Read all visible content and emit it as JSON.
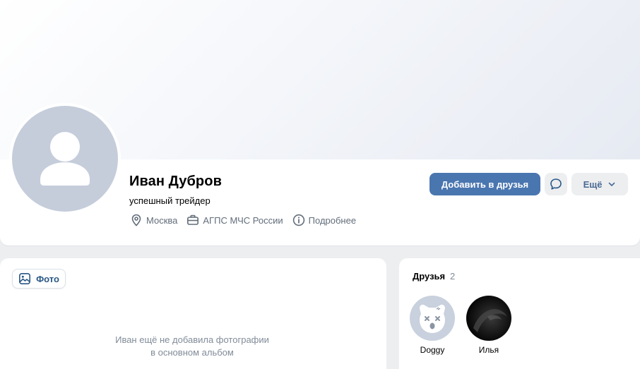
{
  "profile": {
    "name": "Иван Дубров",
    "status": "успешный трейдер",
    "city": "Москва",
    "work": "АГПС МЧС России",
    "more_info": "Подробнее"
  },
  "actions": {
    "add_friend": "Добавить в друзья",
    "more": "Ещё"
  },
  "photos": {
    "tab_label": "Фото",
    "empty_line1": "Иван ещё не добавила фотографии",
    "empty_line2": "в основном альбом"
  },
  "friends": {
    "title": "Друзья",
    "count": "2",
    "items": [
      {
        "name": "Doggy",
        "icon": "deactivated-dog-icon"
      },
      {
        "name": "Илья",
        "icon": "dark-photo"
      }
    ]
  },
  "colors": {
    "accent": "#4a76b0",
    "link": "#2a5885",
    "muted": "#626d7a",
    "page_bg": "#edeef0"
  }
}
